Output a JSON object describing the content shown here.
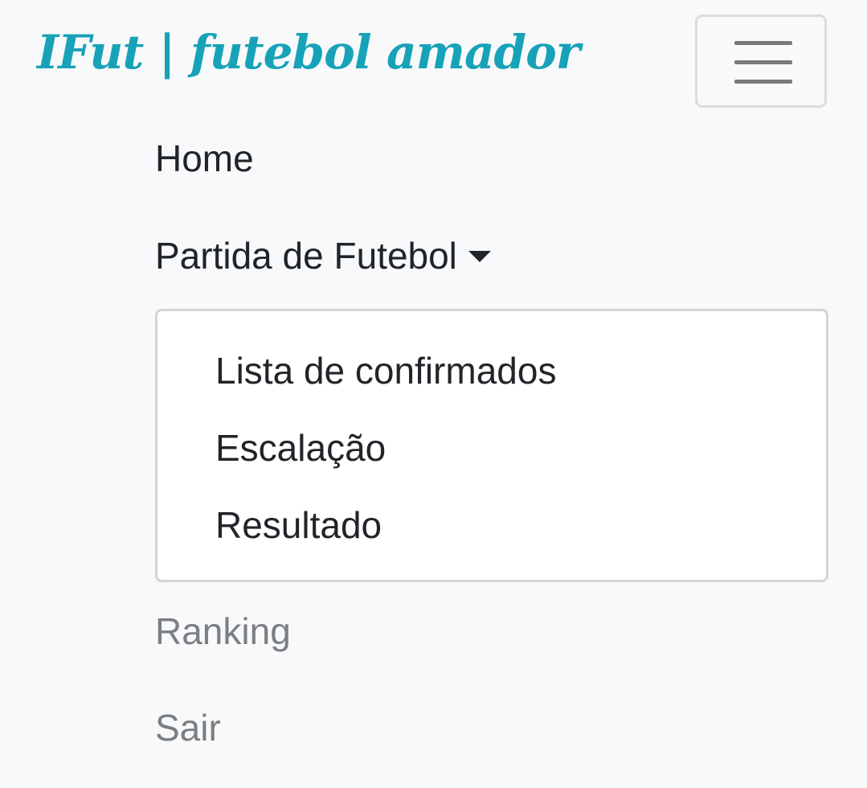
{
  "navbar": {
    "brand": "IFut | futebol amador",
    "toggler_icon": "hamburger-menu-icon",
    "brand_color": "#17a2b8"
  },
  "nav": {
    "home": "Home",
    "partida": "Partida de Futebol",
    "partida_caret_icon": "caret-down-icon",
    "dropdown": {
      "items": [
        "Lista de confirmados",
        "Escalação",
        "Resultado"
      ]
    },
    "ranking": "Ranking",
    "sair": "Sair"
  }
}
